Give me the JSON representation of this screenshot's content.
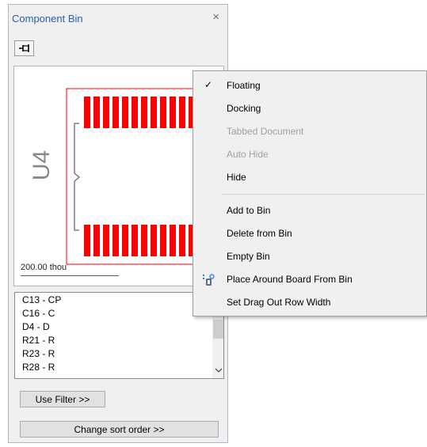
{
  "panel": {
    "title": "Component Bin",
    "close_glyph": "×",
    "pin_icon": "pin-icon",
    "preview": {
      "designator": "U4",
      "scale_label": "200.00 thou",
      "outline_color": "#ff0000",
      "pad_color": "#ff0000"
    },
    "list_items": [
      "C13 - CP",
      "C16 - C",
      "D4 - D",
      "R21 - R",
      "R23 - R",
      "R28 - R"
    ],
    "use_filter_label": "Use Filter >>",
    "sort_label": "Change sort order >>"
  },
  "menu": {
    "items": [
      {
        "label": "Floating",
        "checked": true,
        "enabled": true
      },
      {
        "label": "Docking",
        "checked": false,
        "enabled": true
      },
      {
        "label": "Tabbed Document",
        "checked": false,
        "enabled": false
      },
      {
        "label": "Auto Hide",
        "checked": false,
        "enabled": false
      },
      {
        "label": "Hide",
        "checked": false,
        "enabled": true
      },
      {
        "label": "Add to Bin",
        "checked": false,
        "enabled": true
      },
      {
        "label": "Delete from Bin",
        "checked": false,
        "enabled": true
      },
      {
        "label": "Empty Bin",
        "checked": false,
        "enabled": true
      },
      {
        "label": "Place Around Board From Bin",
        "checked": false,
        "enabled": true,
        "icon": "place-around-board-icon"
      },
      {
        "label": "Set Drag Out Row Width",
        "checked": false,
        "enabled": true
      }
    ],
    "check_glyph": "✓"
  },
  "colors": {
    "title_text": "#2a5dac",
    "panel_bg": "#f0f0f0",
    "menu_bg": "#f0f0f0",
    "disabled_text": "#a0a0a0"
  }
}
